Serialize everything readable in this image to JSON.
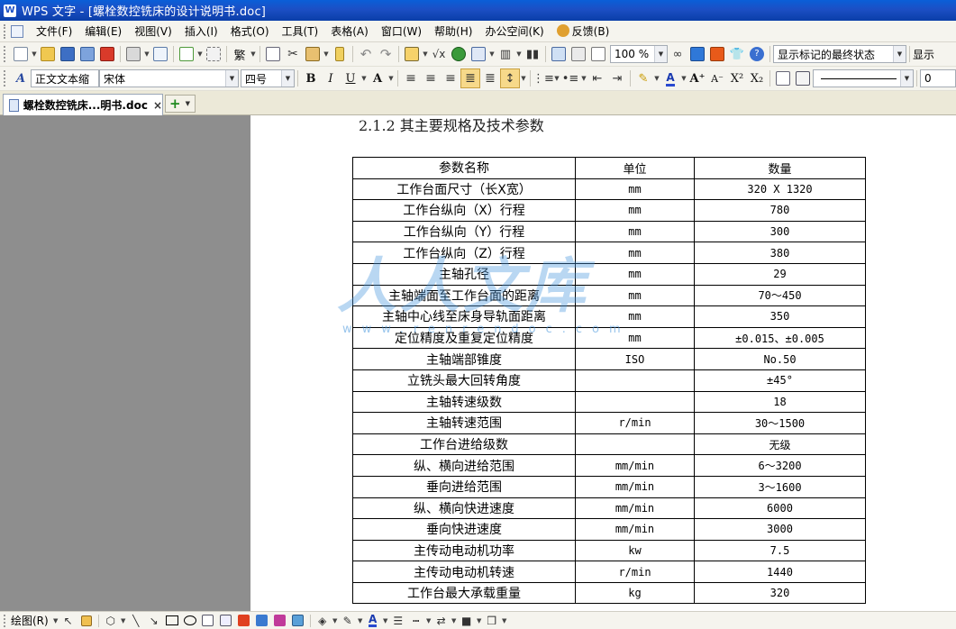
{
  "window": {
    "title": "WPS 文字 - [螺栓数控铣床的设计说明书.doc]",
    "app_badge": "W"
  },
  "menu": {
    "items": [
      "文件(F)",
      "编辑(E)",
      "视图(V)",
      "插入(I)",
      "格式(O)",
      "工具(T)",
      "表格(A)",
      "窗口(W)",
      "帮助(H)",
      "办公空间(K)",
      "反馈(B)"
    ]
  },
  "toolbar": {
    "zoom_value": "100 %",
    "track_changes_value": "显示标记的最终状态",
    "track_changes_overflow": "显示",
    "style_value": "正文文本缩",
    "font_value": "宋体",
    "size_value": "四号",
    "bold_label": "B",
    "italic_label": "I",
    "underline_label": "U",
    "trad_chinese_label": "繁",
    "right_overflow_value": "0"
  },
  "tabs": {
    "doc_tab_label": "螺栓数控铣床...明书.doc",
    "close_symbol": "×"
  },
  "document": {
    "heading": "2.1.2 其主要规格及技术参数",
    "table_headers": [
      "参数名称",
      "单位",
      "数量"
    ],
    "rows": [
      [
        "工作台面尺寸（长X宽）",
        "mm",
        "320 X 1320"
      ],
      [
        "工作台纵向（X）行程",
        "mm",
        "780"
      ],
      [
        "工作台纵向（Y）行程",
        "mm",
        "300"
      ],
      [
        "工作台纵向（Z）行程",
        "mm",
        "380"
      ],
      [
        "主轴孔径",
        "mm",
        "29"
      ],
      [
        "主轴端面至工作台面的距离",
        "mm",
        "70～450"
      ],
      [
        "主轴中心线至床身导轨面距离",
        "mm",
        "350"
      ],
      [
        "定位精度及重复定位精度",
        "mm",
        "±0.015、±0.005"
      ],
      [
        "主轴端部锥度",
        "ISO",
        "No.50"
      ],
      [
        "立铣头最大回转角度",
        "",
        "±45°"
      ],
      [
        "主轴转速级数",
        "",
        "18"
      ],
      [
        "主轴转速范围",
        "r/min",
        "30～1500"
      ],
      [
        "工作台进给级数",
        "",
        "无级"
      ],
      [
        "纵、横向进给范围",
        "mm/min",
        "6～3200"
      ],
      [
        "垂向进给范围",
        "mm/min",
        "3～1600"
      ],
      [
        "纵、横向快进速度",
        "mm/min",
        "6000"
      ],
      [
        "垂向快进速度",
        "mm/min",
        "3000"
      ],
      [
        "主传动电动机功率",
        "kw",
        "7.5"
      ],
      [
        "主传动电动机转速",
        "r/min",
        "1440"
      ],
      [
        "工作台最大承载重量",
        "kg",
        "320"
      ]
    ],
    "watermark_text": "人人文库",
    "watermark_url": "www.renrendoc.com"
  },
  "drawbar": {
    "draw_label": "绘图(R)"
  },
  "colors": {
    "titlebar": "#1c4fc4",
    "workspace_gray": "#8e8e8e",
    "toolbar_bg": "#f5f4ee",
    "watermark_blue": "#4696dc"
  }
}
